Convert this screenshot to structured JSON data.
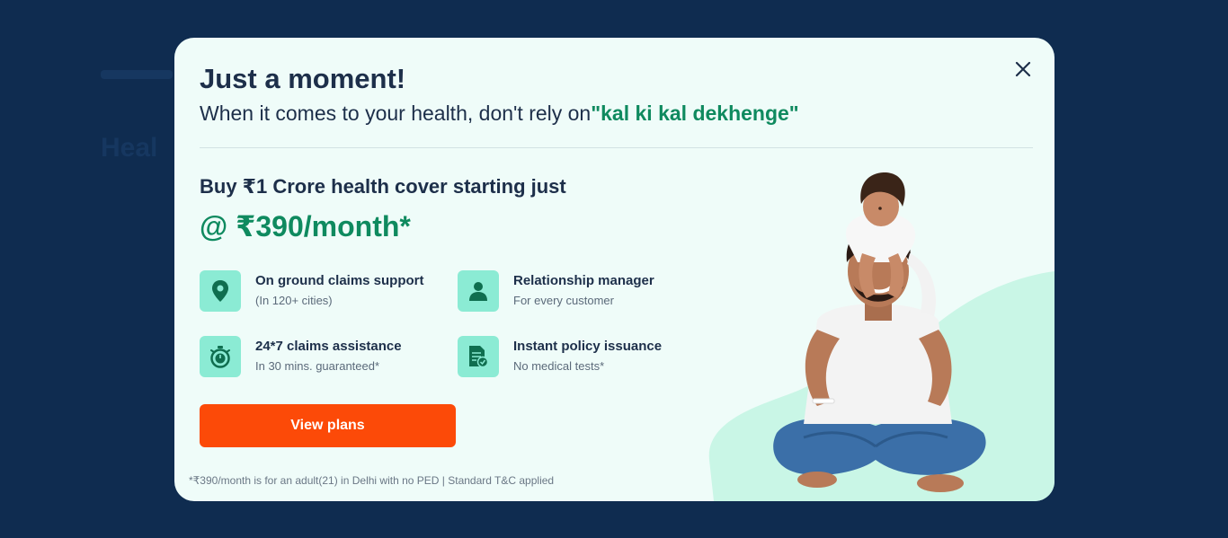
{
  "modal": {
    "heading": "Just a moment!",
    "subheading_prefix": "When it comes to your health, don't rely on",
    "subheading_highlight": "\"kal ki kal dekhenge\"",
    "offer_line": "Buy ₹1 Crore health cover starting just",
    "price": "@ ₹390/month*",
    "features": [
      {
        "icon": "location-pin-icon",
        "title": "On ground claims support",
        "subtitle": "(In 120+ cities)"
      },
      {
        "icon": "person-icon",
        "title": "Relationship manager",
        "subtitle": "For every customer"
      },
      {
        "icon": "stopwatch-icon",
        "title": "24*7 claims assistance",
        "subtitle": "In 30 mins. guaranteed*"
      },
      {
        "icon": "policy-document-icon",
        "title": "Instant policy issuance",
        "subtitle": "No medical tests*"
      }
    ],
    "cta_label": "View plans",
    "disclaimer": "*₹390/month is for an adult(21) in Delhi with no PED | Standard T&C applied"
  },
  "colors": {
    "backdrop": "#0f2c50",
    "modal_bg": "#effcf9",
    "heading": "#1d2f4a",
    "accent_green": "#0f8a5f",
    "icon_tile": "#8bebd4",
    "cta": "#fc4a08"
  }
}
